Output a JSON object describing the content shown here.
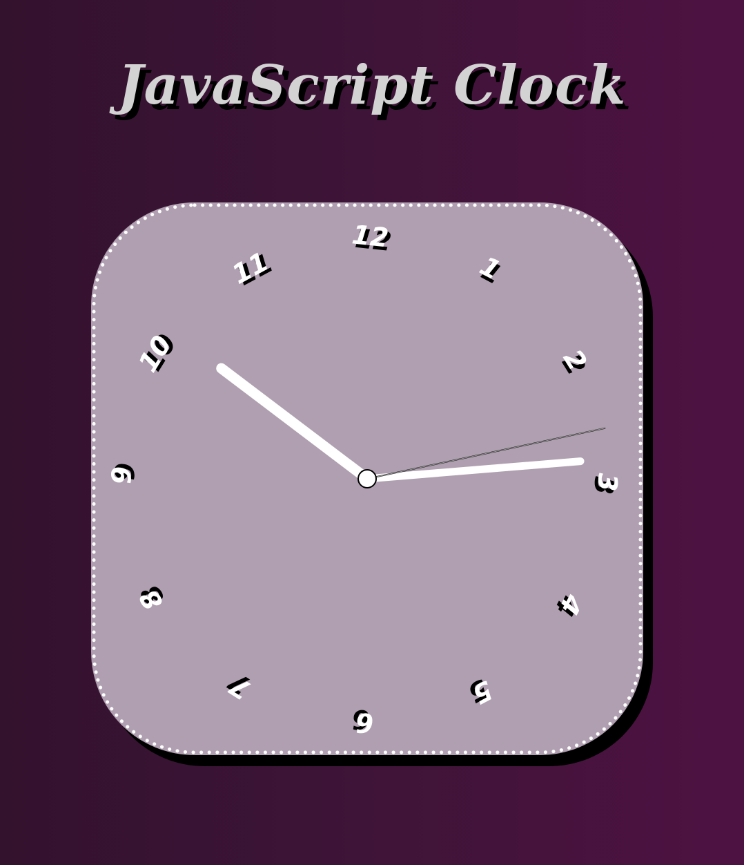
{
  "title": "JavaScript Clock",
  "clock": {
    "numerals": [
      "12",
      "1",
      "2",
      "3",
      "4",
      "5",
      "6",
      "7",
      "8",
      "9",
      "10",
      "11"
    ],
    "time": {
      "hour": 10,
      "minute": 14,
      "second": 13
    },
    "colors": {
      "face": "#b09fb0",
      "hands": "#ffffff",
      "second_hand": "#000000",
      "numeral": "#ffffff",
      "numeral_shadow": "#000000",
      "title": "#d3d3d3",
      "background_start": "#33122e",
      "background_end": "#4e1242"
    }
  }
}
